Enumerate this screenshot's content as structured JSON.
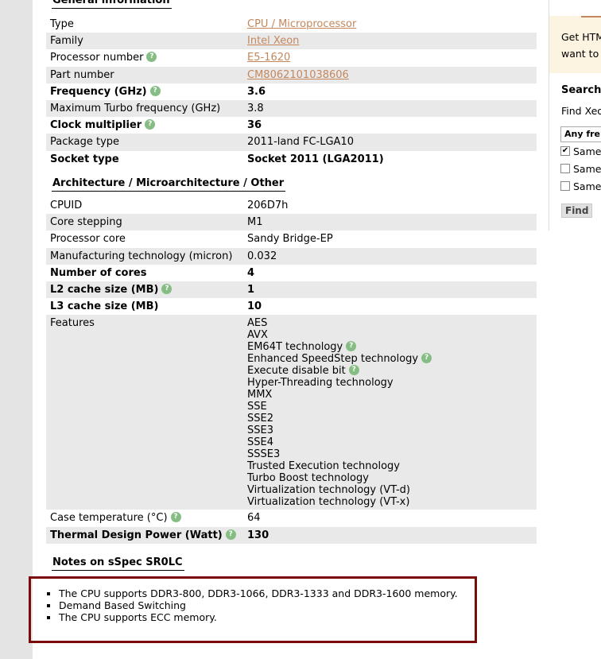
{
  "general": {
    "title": "General information",
    "rows": [
      {
        "label": "Type",
        "value": "CPU / Microprocessor",
        "link": true,
        "help": false,
        "bold": false,
        "shade": false
      },
      {
        "label": "Family",
        "value": "Intel Xeon",
        "link": true,
        "help": false,
        "bold": false,
        "shade": true
      },
      {
        "label": "Processor number",
        "value": "E5-1620",
        "link": true,
        "help": true,
        "bold": false,
        "shade": false
      },
      {
        "label": "Part number",
        "value": "CM8062101038606",
        "link": true,
        "help": false,
        "bold": false,
        "shade": true
      },
      {
        "label": "Frequency (GHz)",
        "value": "3.6",
        "link": false,
        "help": true,
        "bold": true,
        "shade": false
      },
      {
        "label": "Maximum Turbo frequency (GHz)",
        "value": "3.8",
        "link": false,
        "help": false,
        "bold": false,
        "shade": true
      },
      {
        "label": "Clock multiplier",
        "value": "36",
        "link": false,
        "help": true,
        "bold": true,
        "shade": false
      },
      {
        "label": "Package type",
        "value": "2011-land FC-LGA10",
        "link": false,
        "help": false,
        "bold": false,
        "shade": true
      },
      {
        "label": "Socket type",
        "value": "Socket 2011 (LGA2011)",
        "link": false,
        "help": false,
        "bold": true,
        "shade": false
      }
    ]
  },
  "architecture": {
    "title": "Architecture / Microarchitecture / Other",
    "rows": [
      {
        "label": "CPUID",
        "value": "206D7h",
        "help": false,
        "bold": false,
        "shade": false
      },
      {
        "label": "Core stepping",
        "value": "M1",
        "help": false,
        "bold": false,
        "shade": true
      },
      {
        "label": "Processor core",
        "value": "Sandy Bridge-EP",
        "help": false,
        "bold": false,
        "shade": false
      },
      {
        "label": "Manufacturing technology (micron)",
        "value": "0.032",
        "help": false,
        "bold": false,
        "shade": true
      },
      {
        "label": "Number of cores",
        "value": "4",
        "help": false,
        "bold": true,
        "shade": false
      },
      {
        "label": "L2 cache size (MB)",
        "value": "1",
        "help": true,
        "bold": true,
        "shade": true
      },
      {
        "label": "L3 cache size (MB)",
        "value": "10",
        "help": false,
        "bold": true,
        "shade": false
      }
    ],
    "features_label": "Features",
    "features": [
      {
        "name": "AES",
        "help": false
      },
      {
        "name": "AVX",
        "help": false
      },
      {
        "name": "EM64T technology",
        "help": true
      },
      {
        "name": "Enhanced SpeedStep technology",
        "help": true
      },
      {
        "name": "Execute disable bit",
        "help": true
      },
      {
        "name": "Hyper-Threading technology",
        "help": false
      },
      {
        "name": "MMX",
        "help": false
      },
      {
        "name": "SSE",
        "help": false
      },
      {
        "name": "SSE2",
        "help": false
      },
      {
        "name": "SSE3",
        "help": false
      },
      {
        "name": "SSE4",
        "help": false
      },
      {
        "name": "SSSE3",
        "help": false
      },
      {
        "name": "Trusted Execution technology",
        "help": false
      },
      {
        "name": "Turbo Boost technology",
        "help": false
      },
      {
        "name": "Virtualization technology (VT-d)",
        "help": false
      },
      {
        "name": "Virtualization technology (VT-x)",
        "help": false
      }
    ],
    "tail_rows": [
      {
        "label": "Case temperature (°C)",
        "value": "64",
        "help": true,
        "bold": false,
        "shade": false
      },
      {
        "label": "Thermal Design Power (Watt)",
        "value": "130",
        "help": true,
        "bold": true,
        "shade": true
      }
    ]
  },
  "notes": {
    "title": "Notes on sSpec SR0LC",
    "items": [
      "The CPU supports DDR3-800, DDR3-1066, DDR3-1333 and DDR3-1600 memory.",
      "Demand Based Switching",
      "The CPU supports ECC memory."
    ]
  },
  "help_glyph": "?",
  "sidebar": {
    "promo_line1": "Get HTM",
    "promo_line2": "want to",
    "search_title": "Search",
    "find_text": "Find Xeo",
    "select_value": "Any fre",
    "checks": [
      {
        "label": "Same",
        "checked": true
      },
      {
        "label": "Same",
        "checked": false
      },
      {
        "label": "Same",
        "checked": false
      }
    ],
    "check_mark": "✔",
    "find_button": "Find"
  },
  "colors": {
    "link": "#c3875d",
    "help_badge": "#85bd85",
    "notes_border": "#7b0b0b",
    "row_shade": "#e9e9e9"
  }
}
